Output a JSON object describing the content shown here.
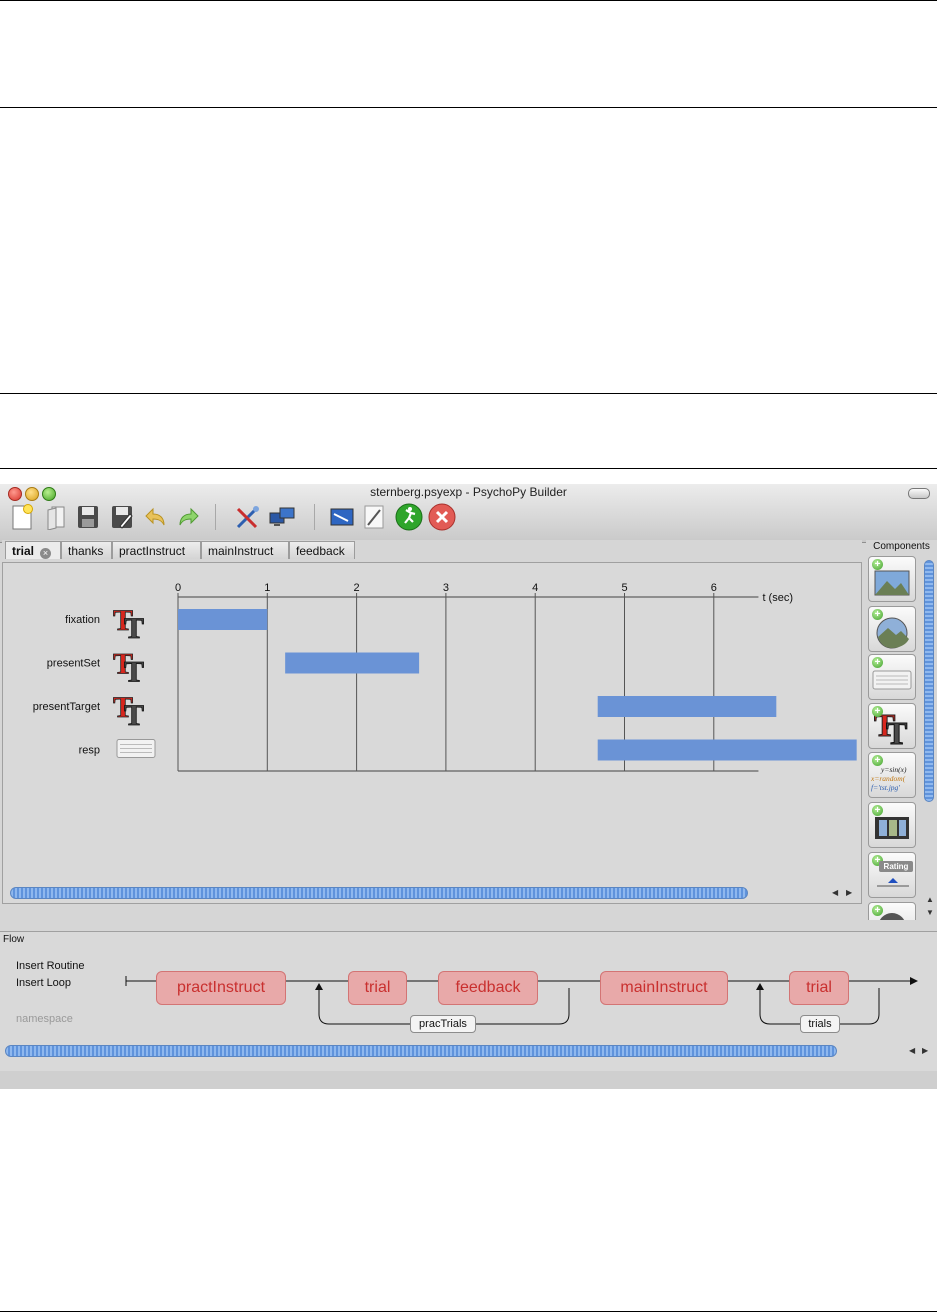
{
  "window": {
    "title": "sternberg.psyexp - PsychoPy Builder"
  },
  "toolbar": {
    "buttons": [
      {
        "name": "new-file-icon"
      },
      {
        "name": "open-file-icon"
      },
      {
        "name": "save-icon"
      },
      {
        "name": "save-as-icon"
      },
      {
        "name": "undo-icon"
      },
      {
        "name": "redo-icon"
      },
      {
        "name": "preferences-icon"
      },
      {
        "name": "monitor-center-icon"
      },
      {
        "name": "experiment-settings-icon"
      },
      {
        "name": "compile-script-icon"
      },
      {
        "name": "run-icon"
      },
      {
        "name": "stop-icon"
      }
    ]
  },
  "routine_tabs": [
    {
      "label": "trial",
      "active": true
    },
    {
      "label": "thanks"
    },
    {
      "label": "practInstruct"
    },
    {
      "label": "mainInstruct"
    },
    {
      "label": "feedback"
    }
  ],
  "timeline": {
    "axis_label": "t (sec)",
    "ticks": [
      "0",
      "1",
      "2",
      "3",
      "4",
      "5",
      "6"
    ],
    "axis_max": 6.5,
    "bar_color": "#6a93d6",
    "components": [
      {
        "name": "fixation",
        "icon": "text-icon",
        "start": 0.0,
        "end": 1.0
      },
      {
        "name": "presentSet",
        "icon": "text-icon",
        "start": 1.2,
        "end": 2.7
      },
      {
        "name": "presentTarget",
        "icon": "text-icon",
        "start": 4.7,
        "end": 6.7
      },
      {
        "name": "resp",
        "icon": "keyboard-icon",
        "start": 4.7,
        "end": 7.6
      }
    ]
  },
  "components_panel": {
    "title": "Components",
    "items": [
      {
        "name": "image-component-icon"
      },
      {
        "name": "patch-component-icon"
      },
      {
        "name": "keyboard-component-icon"
      },
      {
        "name": "text-component-icon"
      },
      {
        "name": "code-component-icon",
        "lines": [
          "y=sin(x)",
          "x=random(",
          "f='tst.jpg'"
        ]
      },
      {
        "name": "movie-component-icon"
      },
      {
        "name": "rating-component-icon",
        "label": "Rating"
      },
      {
        "name": "sound-component-icon"
      }
    ]
  },
  "flow": {
    "title": "Flow",
    "insert_routine": "Insert Routine",
    "insert_loop": "Insert Loop",
    "namespace": "namespace",
    "routines": [
      "practInstruct",
      "trial",
      "feedback",
      "mainInstruct",
      "trial"
    ],
    "loops": [
      "pracTrials",
      "trials"
    ]
  }
}
